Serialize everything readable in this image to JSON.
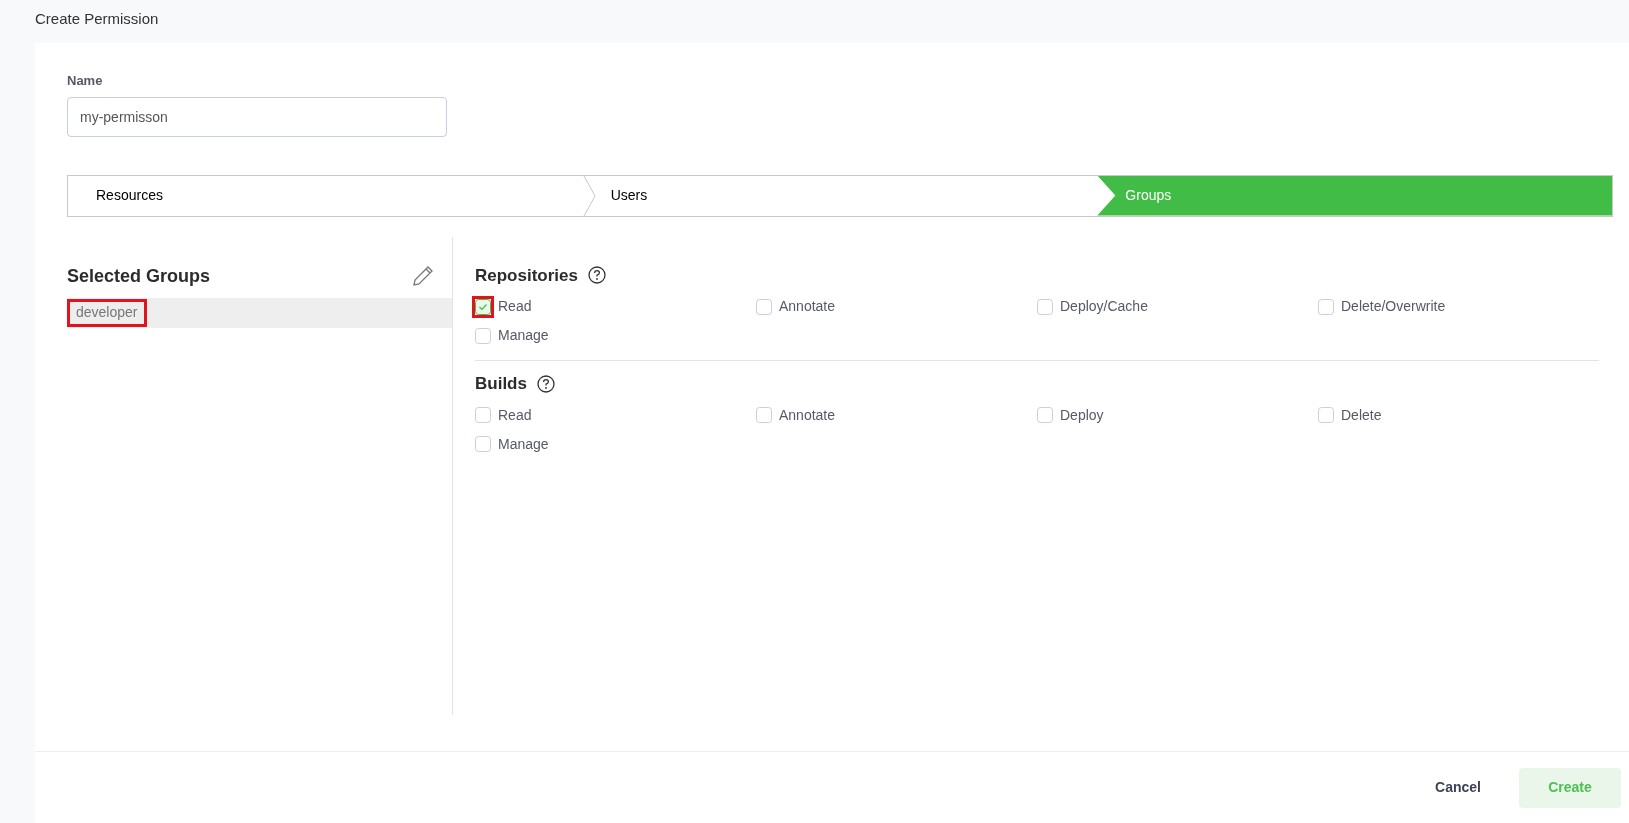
{
  "page": {
    "title": "Create Permission"
  },
  "name_field": {
    "label": "Name",
    "value": "my-permisson"
  },
  "steps": [
    {
      "label": "Resources",
      "selected": false
    },
    {
      "label": "Users",
      "selected": false
    },
    {
      "label": "Groups",
      "selected": true
    }
  ],
  "selected_groups": {
    "title": "Selected Groups",
    "items": [
      {
        "label": "developer",
        "highlighted": true
      }
    ]
  },
  "sections": [
    {
      "title": "Repositories",
      "options": [
        {
          "label": "Read",
          "checked": true,
          "highlighted": true
        },
        {
          "label": "Annotate",
          "checked": false,
          "highlighted": false
        },
        {
          "label": "Deploy/Cache",
          "checked": false,
          "highlighted": false
        },
        {
          "label": "Delete/Overwrite",
          "checked": false,
          "highlighted": false
        },
        {
          "label": "Manage",
          "checked": false,
          "highlighted": false
        }
      ]
    },
    {
      "title": "Builds",
      "options": [
        {
          "label": "Read",
          "checked": false,
          "highlighted": false
        },
        {
          "label": "Annotate",
          "checked": false,
          "highlighted": false
        },
        {
          "label": "Deploy",
          "checked": false,
          "highlighted": false
        },
        {
          "label": "Delete",
          "checked": false,
          "highlighted": false
        },
        {
          "label": "Manage",
          "checked": false,
          "highlighted": false
        }
      ]
    }
  ],
  "buttons": [
    {
      "label": "Cancel",
      "kind": "link"
    },
    {
      "label": "Create",
      "kind": "primary"
    }
  ]
}
